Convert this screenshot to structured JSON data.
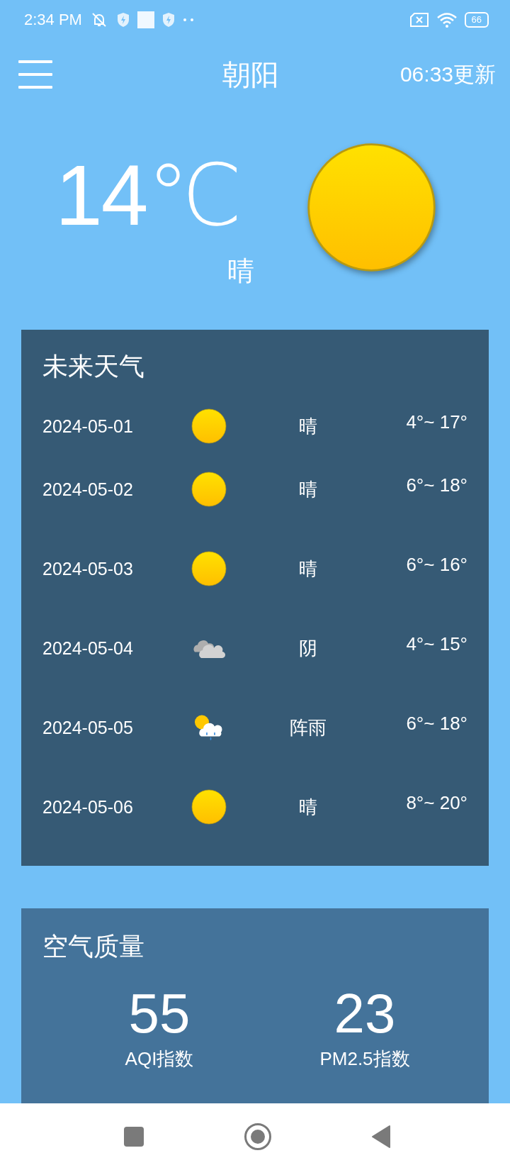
{
  "status_bar": {
    "time": "2:34 PM",
    "battery": "66"
  },
  "app_bar": {
    "city": "朝阳",
    "updated": "06:33更新"
  },
  "now": {
    "temperature": "14℃",
    "condition": "晴",
    "kind": "sunny"
  },
  "forecast": {
    "title": "未来天气",
    "days": [
      {
        "date": "2024-05-01",
        "kind": "sunny",
        "condition": "晴",
        "range": "4°~ 17°"
      },
      {
        "date": "2024-05-02",
        "kind": "sunny",
        "condition": "晴",
        "range": "6°~ 18°"
      },
      {
        "date": "2024-05-03",
        "kind": "sunny",
        "condition": "晴",
        "range": "6°~ 16°"
      },
      {
        "date": "2024-05-04",
        "kind": "cloudy",
        "condition": "阴",
        "range": "4°~ 15°"
      },
      {
        "date": "2024-05-05",
        "kind": "shower",
        "condition": "阵雨",
        "range": "6°~ 18°"
      },
      {
        "date": "2024-05-06",
        "kind": "sunny",
        "condition": "晴",
        "range": "8°~ 20°"
      }
    ]
  },
  "air_quality": {
    "title": "空气质量",
    "metrics": [
      {
        "value": "55",
        "label": "AQI指数"
      },
      {
        "value": "23",
        "label": "PM2.5指数"
      }
    ]
  }
}
